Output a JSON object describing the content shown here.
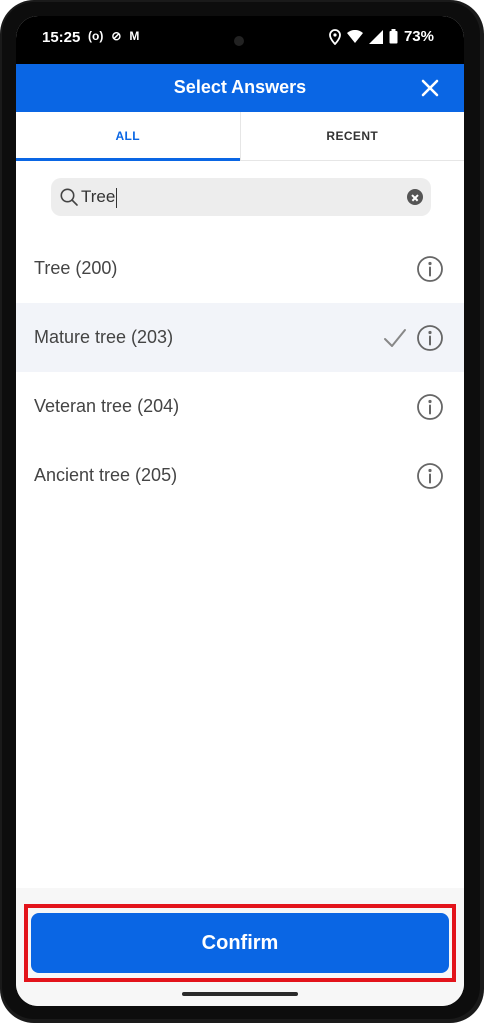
{
  "status": {
    "time": "15:25",
    "battery": "73%",
    "left_icons": [
      "(o)",
      "⊘",
      "M"
    ]
  },
  "header": {
    "title": "Select Answers",
    "close_icon": "close-icon"
  },
  "tabs": [
    {
      "label": "ALL",
      "active": true
    },
    {
      "label": "RECENT",
      "active": false
    }
  ],
  "search": {
    "value": "Tree"
  },
  "items": [
    {
      "label": "Tree (200)",
      "selected": false
    },
    {
      "label": "Mature tree (203)",
      "selected": true
    },
    {
      "label": "Veteran tree (204)",
      "selected": false
    },
    {
      "label": "Ancient tree (205)",
      "selected": false
    }
  ],
  "footer": {
    "confirm_label": "Confirm"
  },
  "colors": {
    "accent": "#0a66e4",
    "highlight": "#e3141b"
  }
}
